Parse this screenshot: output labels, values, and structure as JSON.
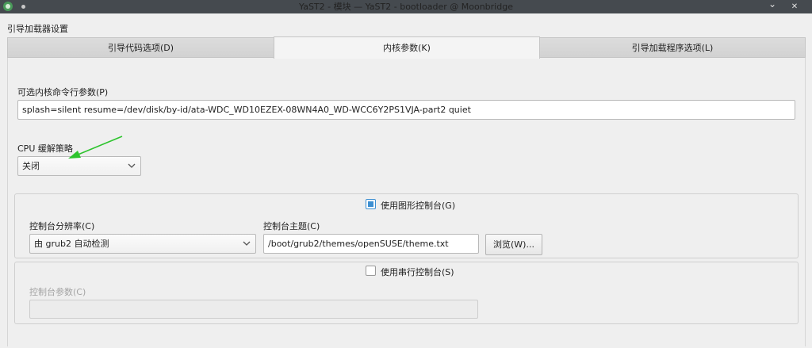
{
  "window": {
    "title": "YaST2 - 模块 — YaST2 - bootloader @ Moonbridge",
    "minimize_glyph": "⌄",
    "close_glyph": "✕",
    "app_icon": "yast-app-icon",
    "pin_icon": "pin-dot-icon"
  },
  "dialog": {
    "title": "引导加载器设置"
  },
  "tabs": [
    {
      "label": "引导代码选项(D)",
      "active": false
    },
    {
      "label": "内核参数(K)",
      "active": true
    },
    {
      "label": "引导加载程序选项(L)",
      "active": false
    }
  ],
  "kernel": {
    "params_label": "可选内核命令行参数(P)",
    "params_value": "splash=silent resume=/dev/disk/by-id/ata-WDC_WD10EZEX-08WN4A0_WD-WCC6Y2PS1VJA-part2 quiet"
  },
  "cpu": {
    "label": "CPU 缓解策略",
    "selected": "关闭"
  },
  "graphical_console": {
    "checkbox_label": "使用图形控制台(G)",
    "checked": true,
    "resolution_label": "控制台分辨率(C)",
    "resolution_value": "由 grub2 自动检测",
    "theme_label": "控制台主题(C)",
    "theme_value": "/boot/grub2/themes/openSUSE/theme.txt",
    "browse_label": "浏览(W)..."
  },
  "serial_console": {
    "checkbox_label": "使用串行控制台(S)",
    "checked": false,
    "params_label": "控制台参数(C)",
    "params_value": ""
  },
  "colors": {
    "accent": "#3d8fd1",
    "annotation_arrow": "#2ec42e",
    "titlebar": "#454a4f"
  },
  "icons": {
    "dropdown": "chevron-down-icon"
  }
}
